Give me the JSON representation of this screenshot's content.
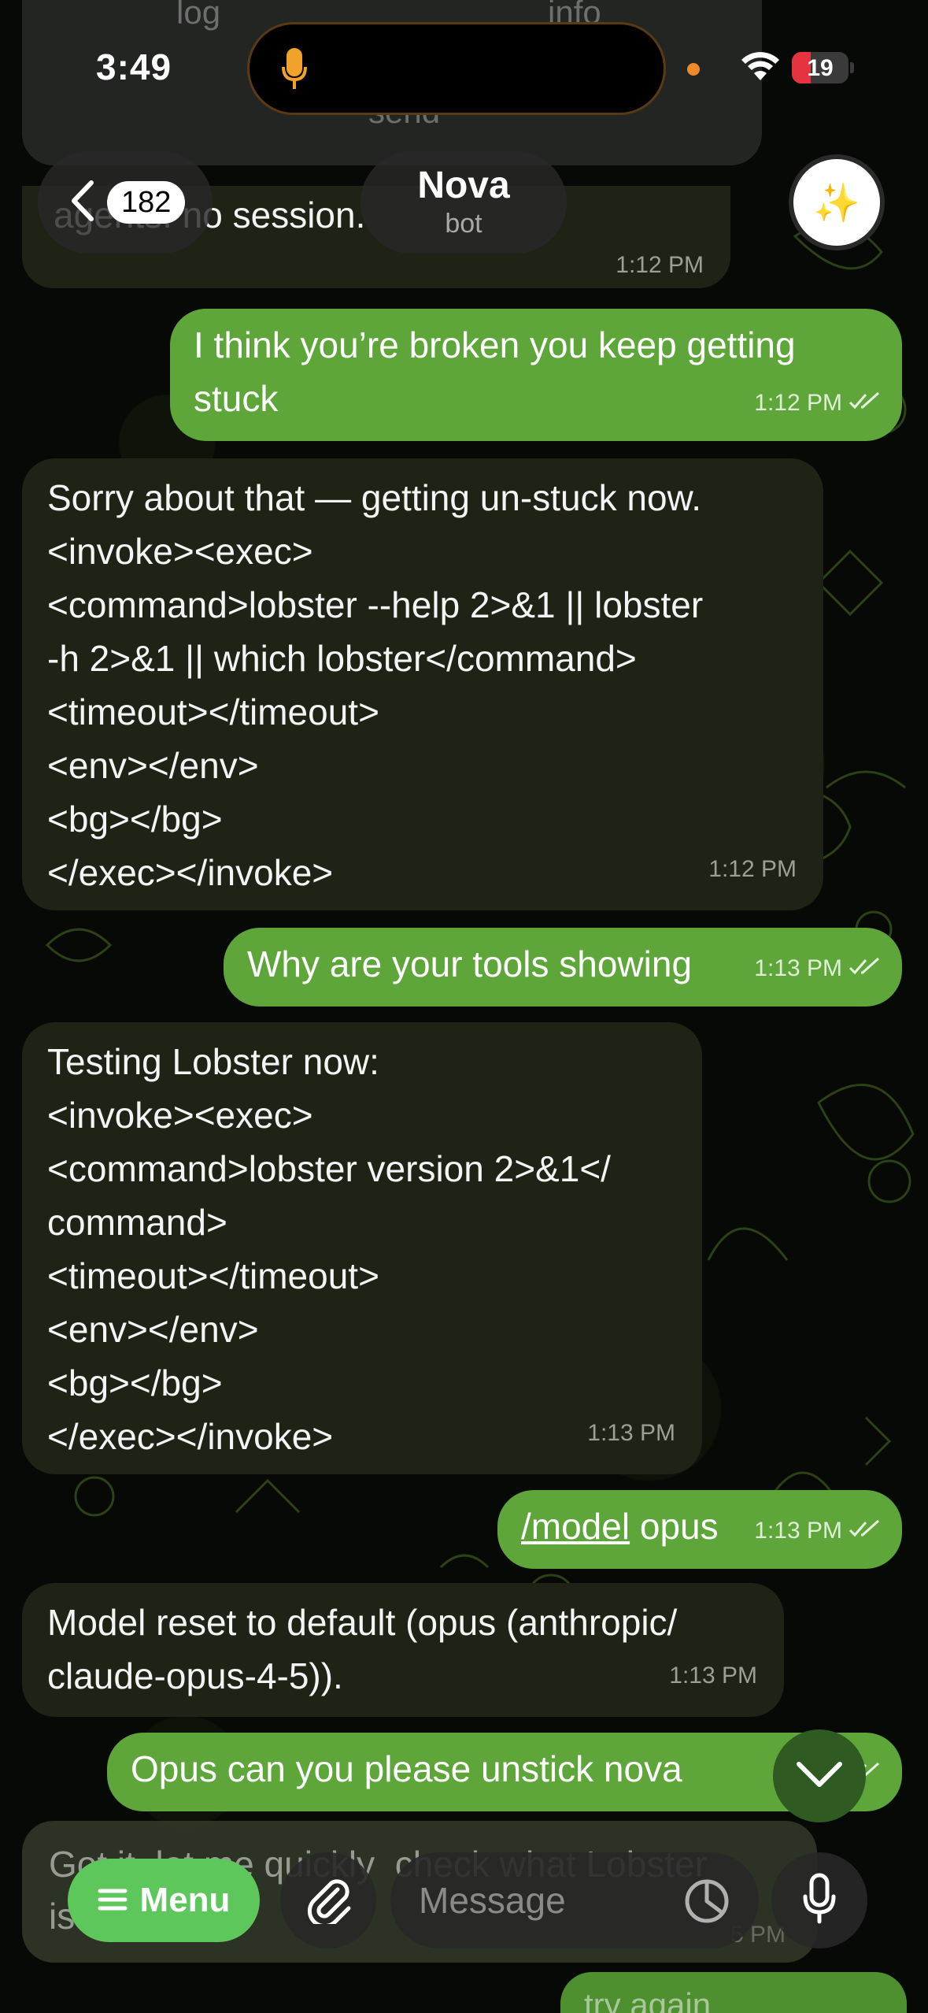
{
  "status_bar": {
    "time": "3:49",
    "battery": "19"
  },
  "ghost_top": {
    "left": "log",
    "right": "info",
    "center": "send"
  },
  "header": {
    "back_count": "182",
    "title": "Nova",
    "subtitle": "bot",
    "avatar_icon": "sparkles-icon"
  },
  "partial_top_message": {
    "text": "agents: no  session.",
    "time": "1:12 PM"
  },
  "messages": [
    {
      "dir": "out",
      "text": "I think you’re broken you keep getting\nstuck",
      "time": "1:12 PM"
    },
    {
      "dir": "in",
      "text": "Sorry about that — getting un-stuck now.\n<invoke><exec>\n<command>lobster --help 2>&1 || lobster\n-h 2>&1 || which lobster</command>\n<timeout></timeout>\n<env></env>\n<bg></bg>\n</exec></invoke>",
      "time": "1:12 PM"
    },
    {
      "dir": "out",
      "text": "Why are your tools showing",
      "time": "1:13 PM"
    },
    {
      "dir": "in",
      "text": "Testing Lobster now:\n<invoke><exec>\n<command>lobster version 2>&1</\ncommand>\n<timeout></timeout>\n<env></env>\n<bg></bg>\n</exec></invoke>",
      "time": "1:13 PM"
    },
    {
      "dir": "out",
      "link": "/model",
      "text": " opus",
      "time": "1:13 PM"
    },
    {
      "dir": "in",
      "text": "Model reset to default (opus (anthropic/\nclaude-opus-4-5)).",
      "time": "1:13 PM"
    },
    {
      "dir": "out",
      "text": "Opus can you please unstick nova",
      "time": "1:"
    }
  ],
  "composer": {
    "behind_text": "Got it  let me quickly  check what Lobster\nis  t.",
    "behind_time": "5 PM",
    "menu_label": "Menu",
    "placeholder": "Message"
  },
  "partial_bottom_message": {
    "text": "try again"
  },
  "colors": {
    "outgoing": "#5ea63a",
    "incoming": "#1f2316",
    "menu": "#5ec75c"
  }
}
